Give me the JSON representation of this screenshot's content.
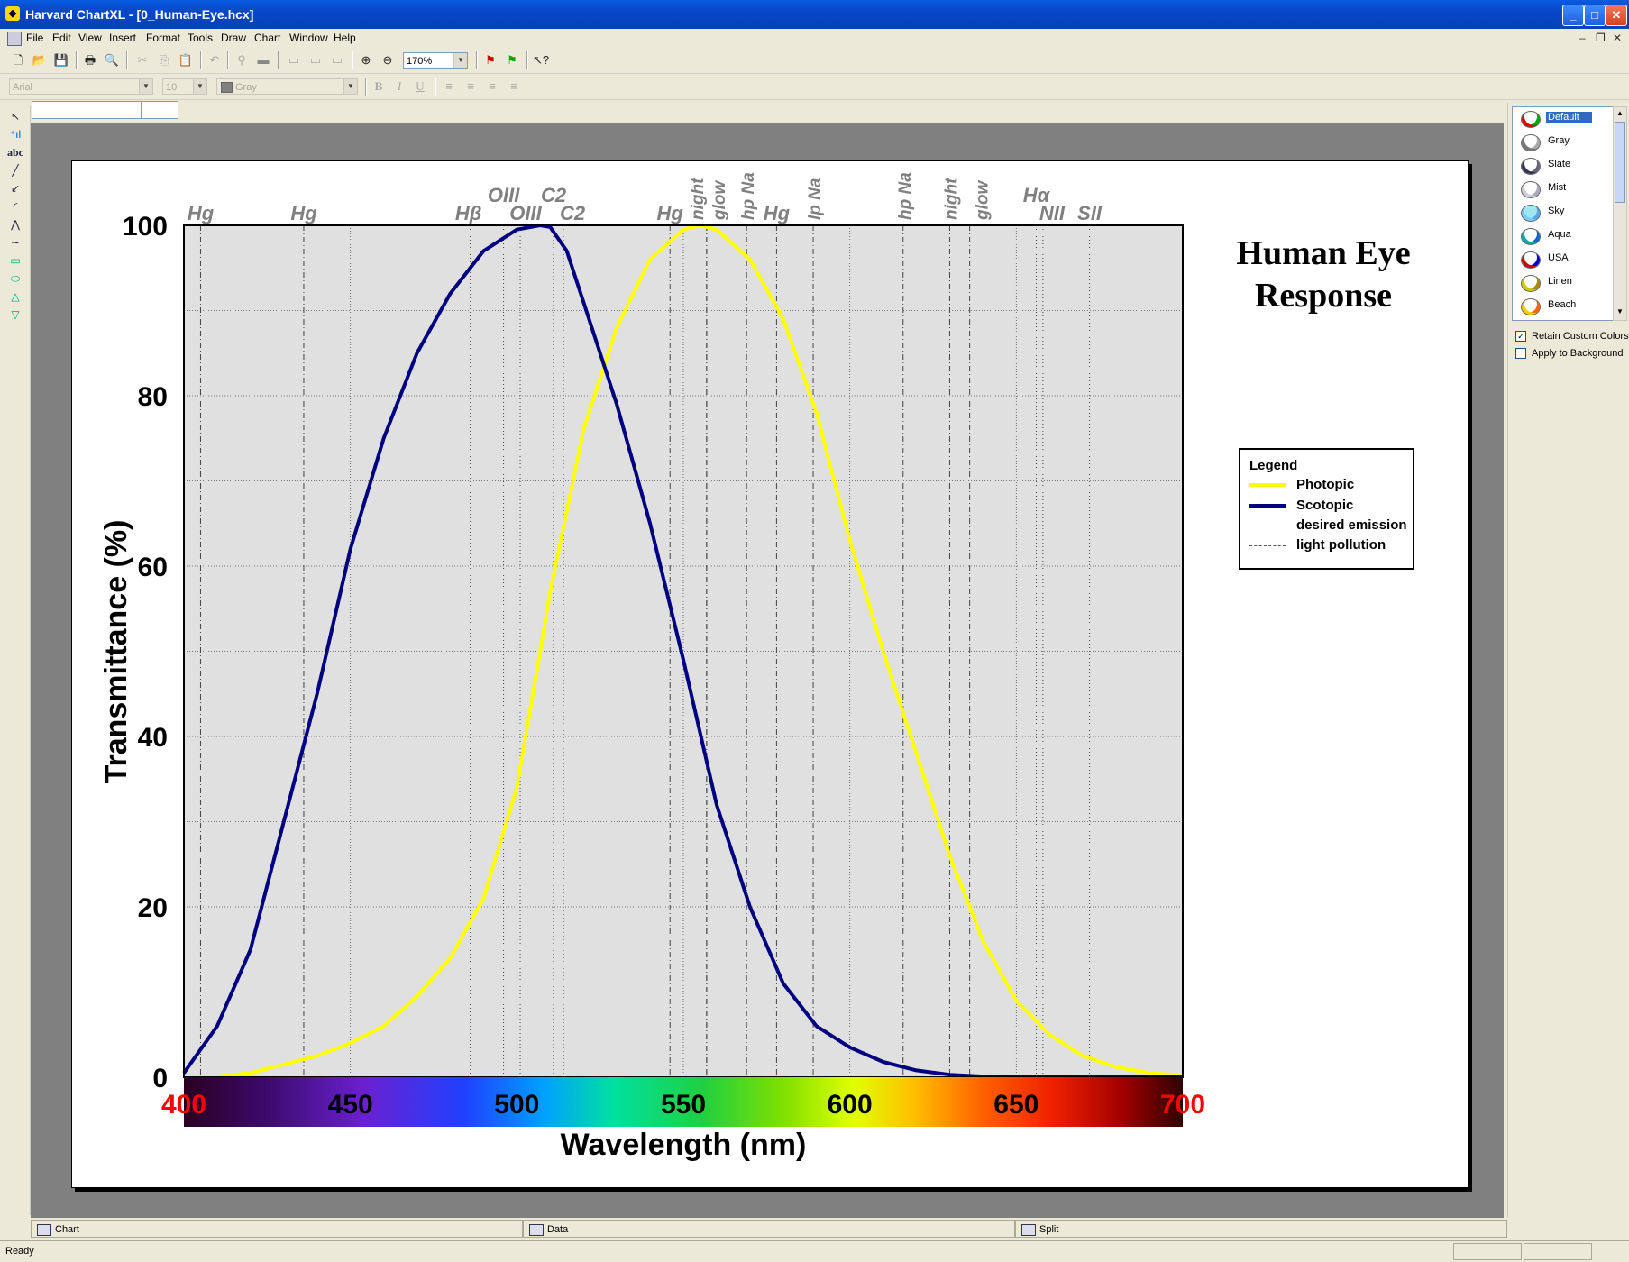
{
  "window": {
    "title": "Harvard ChartXL - [0_Human-Eye.hcx]",
    "controls": [
      "_",
      "□",
      "✕"
    ]
  },
  "menu": [
    "File",
    "Edit",
    "View",
    "Insert",
    "Format",
    "Tools",
    "Draw",
    "Chart",
    "Window",
    "Help"
  ],
  "toolbar": {
    "zoom": "170%"
  },
  "format_toolbar": {
    "font": "Arial",
    "size": "10",
    "color": "Gray",
    "bold": "B",
    "italic": "I",
    "underline": "U"
  },
  "palette_text_tool": "abc",
  "color_schemes": {
    "items": [
      "Default",
      "Gray",
      "Slate",
      "Mist",
      "Sky",
      "Aqua",
      "USA",
      "Linen",
      "Beach"
    ],
    "selected": "Default",
    "retain_custom_colors": "Retain Custom Colors",
    "apply_to_background": "Apply to Background"
  },
  "tabs": [
    "Chart",
    "Data",
    "Split"
  ],
  "status": "Ready",
  "chart_data": {
    "type": "line",
    "title": "Human Eye Response",
    "xlabel": "Wavelength (nm)",
    "ylabel": "Transmittance (%)",
    "xlim": [
      400,
      700
    ],
    "ylim": [
      0,
      100
    ],
    "x_ticks": [
      "400",
      "450",
      "500",
      "550",
      "600",
      "650",
      "700"
    ],
    "y_ticks": [
      "0",
      "20",
      "40",
      "60",
      "80",
      "100"
    ],
    "grid": true,
    "legend": {
      "title": "Legend",
      "position": "right",
      "entries": [
        "Photopic",
        "Scotopic",
        "desired emission",
        "light pollution"
      ]
    },
    "colors": {
      "photopic": "#ffff00",
      "scotopic": "#000080",
      "plot_bg": "#e0e0e0"
    },
    "series": [
      {
        "name": "Photopic",
        "x": [
          400,
          410,
          420,
          430,
          440,
          450,
          460,
          470,
          480,
          490,
          500,
          507,
          510,
          520,
          530,
          540,
          550,
          555,
          560,
          570,
          580,
          590,
          600,
          610,
          620,
          630,
          640,
          650,
          660,
          670,
          680,
          690,
          700
        ],
        "values": [
          0,
          0.1,
          0.5,
          1.5,
          2.5,
          4,
          6,
          9.5,
          14,
          21,
          34,
          50,
          57,
          76,
          88,
          96,
          99.5,
          100,
          99.5,
          96,
          89,
          78,
          63,
          50,
          38,
          26,
          16,
          9,
          5,
          2.5,
          1.2,
          0.5,
          0.2
        ]
      },
      {
        "name": "Scotopic",
        "x": [
          400,
          410,
          420,
          430,
          440,
          450,
          460,
          470,
          480,
          490,
          500,
          507,
          510,
          515,
          520,
          530,
          540,
          550,
          560,
          570,
          580,
          590,
          600,
          610,
          620,
          630,
          640,
          650,
          660,
          670,
          680,
          690,
          700
        ],
        "values": [
          0.5,
          6,
          15,
          30,
          45,
          62,
          75,
          85,
          92,
          97,
          99.5,
          100,
          99.8,
          97,
          91,
          79,
          65,
          49,
          32,
          20,
          11,
          6,
          3.5,
          1.8,
          0.8,
          0.3,
          0.1,
          0,
          0,
          0,
          0,
          0,
          0
        ]
      }
    ],
    "emission_lines": [
      {
        "label": "Hg",
        "x": 405,
        "style": "light pollution"
      },
      {
        "label": "Hg",
        "x": 436,
        "style": "light pollution"
      },
      {
        "label": "Hβ",
        "x": 486,
        "style": "desired emission"
      },
      {
        "label": "OIII",
        "x": 496,
        "style": "desired emission"
      },
      {
        "label": "OIII",
        "x": 501,
        "style": "desired emission"
      },
      {
        "label": "C2",
        "x": 511,
        "style": "desired emission"
      },
      {
        "label": "C2",
        "x": 514,
        "style": "desired emission"
      },
      {
        "label": "Hg",
        "x": 546,
        "style": "light pollution"
      },
      {
        "label": "night",
        "x": 557,
        "style": "light pollution"
      },
      {
        "label": "glow",
        "x": 557,
        "style": "light pollution"
      },
      {
        "label": "hp Na",
        "x": 569,
        "style": "light pollution"
      },
      {
        "label": "Hg",
        "x": 578,
        "style": "light pollution"
      },
      {
        "label": "lp Na",
        "x": 589,
        "style": "light pollution"
      },
      {
        "label": "hp Na",
        "x": 616,
        "style": "light pollution"
      },
      {
        "label": "night",
        "x": 630,
        "style": "light pollution"
      },
      {
        "label": "glow",
        "x": 636,
        "style": "light pollution"
      },
      {
        "label": "Hα",
        "x": 656,
        "style": "desired emission"
      },
      {
        "label": "NII",
        "x": 658,
        "style": "desired emission"
      },
      {
        "label": "SII",
        "x": 672,
        "style": "desired emission"
      }
    ]
  }
}
